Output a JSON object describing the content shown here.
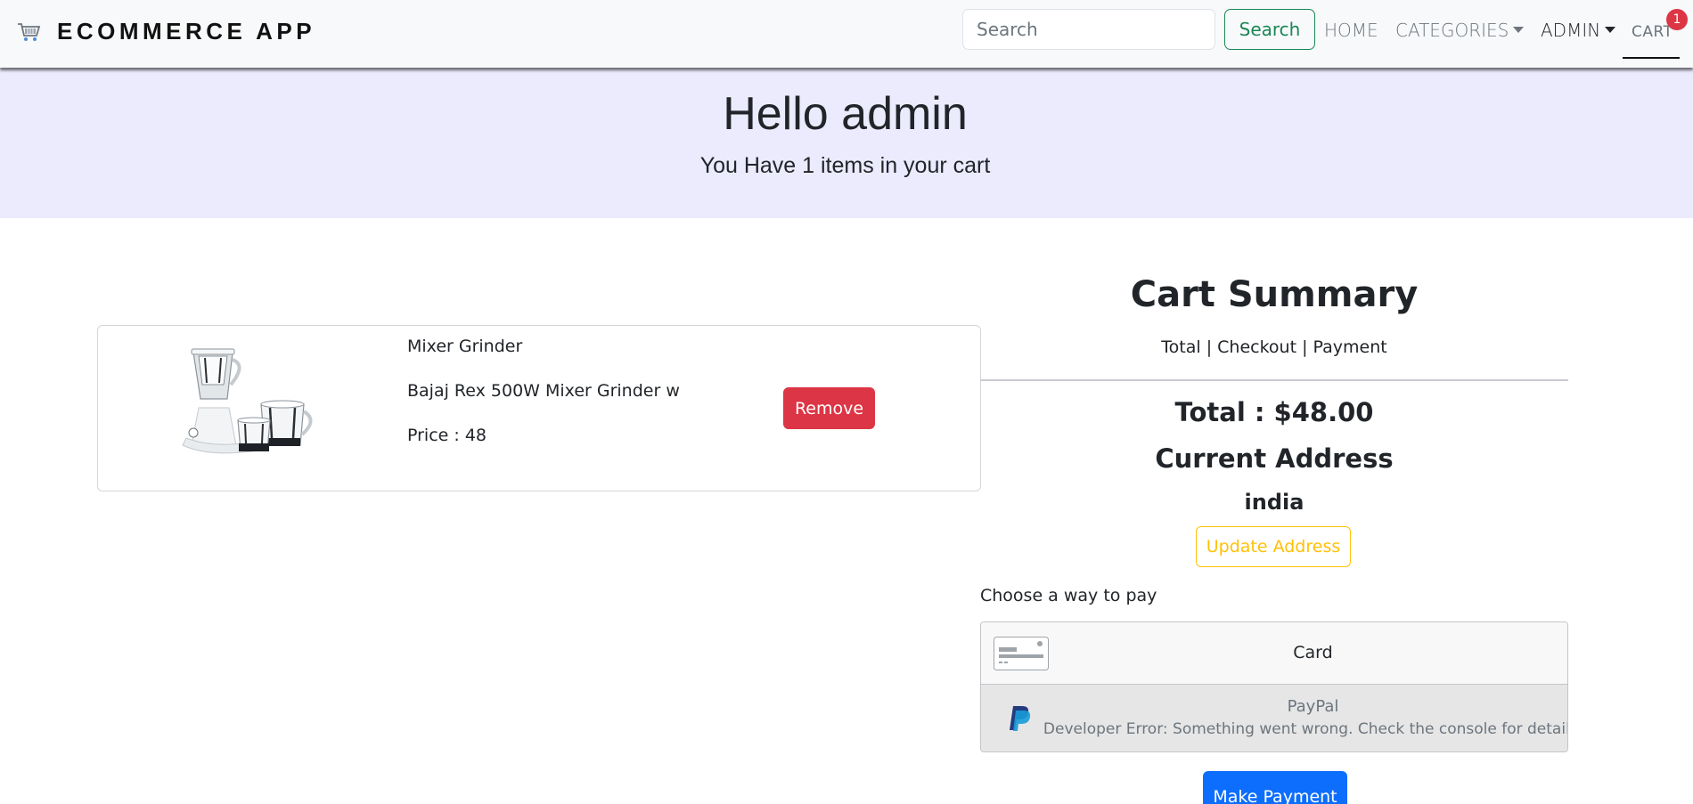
{
  "navbar": {
    "brand": "ECOMMERCE APP",
    "brand_icon": "shopping-cart-icon",
    "search_placeholder": "Search",
    "search_button": "Search",
    "links": {
      "home": "HOME",
      "categories": "CATEGORIES",
      "admin": "ADMIN",
      "cart": "CART"
    },
    "cart_count": "1"
  },
  "hero": {
    "title": "Hello admin",
    "subtitle": "You Have 1 items in your cart"
  },
  "cart_items": [
    {
      "name": "Mixer Grinder",
      "description": "Bajaj Rex 500W Mixer Grinder w",
      "price_text": "Price : 48",
      "remove_label": "Remove"
    }
  ],
  "summary": {
    "title": "Cart Summary",
    "subtitle": "Total | Checkout | Payment",
    "total": "Total : $48.00",
    "address_title": "Current Address",
    "address": "india",
    "update_address": "Update Address",
    "pay_prompt": "Choose a way to pay",
    "methods": {
      "card": "Card",
      "paypal": "PayPal",
      "paypal_error": "Developer Error: Something went wrong. Check the console for details."
    },
    "make_payment": "Make Payment"
  },
  "colors": {
    "hero_bg": "#ebebfd",
    "success": "#198754",
    "danger": "#dc3545",
    "warning": "#ffc107",
    "primary": "#0d6efd"
  }
}
